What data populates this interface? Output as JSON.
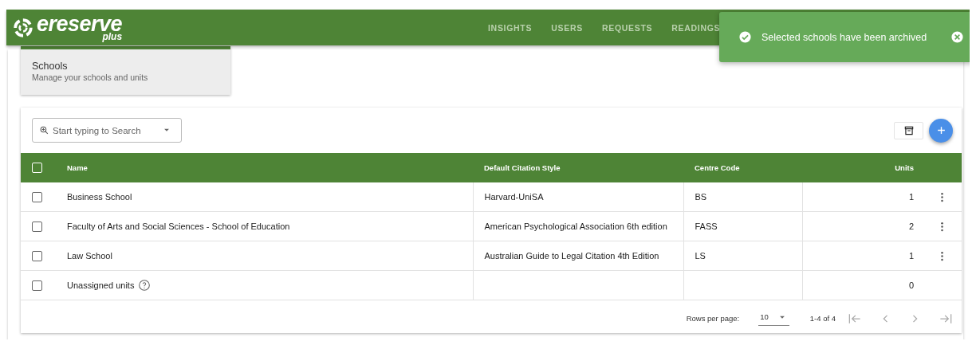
{
  "header": {
    "logo": "ereserve",
    "logo_sub": "plus",
    "nav": [
      "INSIGHTS",
      "USERS",
      "REQUESTS",
      "READINGS"
    ]
  },
  "toast": {
    "message": "Selected schools have been archived"
  },
  "page_tab": {
    "title": "Schools",
    "subtitle": "Manage your schools and units"
  },
  "search": {
    "placeholder": "Start typing to Search"
  },
  "table": {
    "select_all_checked": false,
    "columns": [
      "Name",
      "Default Citation Style",
      "Centre Code",
      "Units"
    ],
    "rows": [
      {
        "kind": "school",
        "checked": false,
        "name": "Business School",
        "citation": "Harvard-UniSA",
        "code": "BS",
        "units": "1"
      },
      {
        "kind": "school",
        "checked": false,
        "name": "Faculty of Arts and Social Sciences - School of Education",
        "citation": "American Psychological Association 6th edition",
        "code": "FASS",
        "units": "2"
      },
      {
        "kind": "school",
        "checked": false,
        "name": "Law School",
        "citation": "Australian Guide to Legal Citation 4th Edition",
        "code": "LS",
        "units": "1"
      },
      {
        "kind": "unassigned",
        "checked": false,
        "name": "Unassigned units",
        "units": "0"
      }
    ]
  },
  "pagination": {
    "rows_label": "Rows per page:",
    "rows_value": "10",
    "range": "1-4 of 4",
    "buttons": [
      {
        "kind": "first",
        "disabled": true
      },
      {
        "kind": "prev",
        "disabled": true
      },
      {
        "kind": "next",
        "disabled": true
      },
      {
        "kind": "last",
        "disabled": true
      }
    ]
  }
}
